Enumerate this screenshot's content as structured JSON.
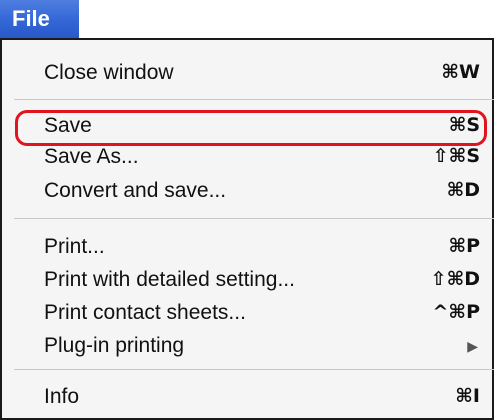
{
  "menu": {
    "title": "File",
    "highlight_color": "#e0141f",
    "title_bg_color": "#3366d6",
    "items": [
      {
        "label": "Close window",
        "shortcut": "⌘W"
      },
      {
        "label": "Save",
        "shortcut": "⌘S"
      },
      {
        "label": "Save As...",
        "shortcut": "⇧⌘S"
      },
      {
        "label": "Convert and save...",
        "shortcut": "⌘D"
      },
      {
        "label": "Print...",
        "shortcut": "⌘P"
      },
      {
        "label": "Print with detailed setting...",
        "shortcut": "⇧⌘D"
      },
      {
        "label": "Print contact sheets...",
        "shortcut": "^⌘P"
      },
      {
        "label": "Plug-in printing",
        "shortcut": "▶"
      },
      {
        "label": "Info",
        "shortcut": "⌘I"
      }
    ]
  }
}
